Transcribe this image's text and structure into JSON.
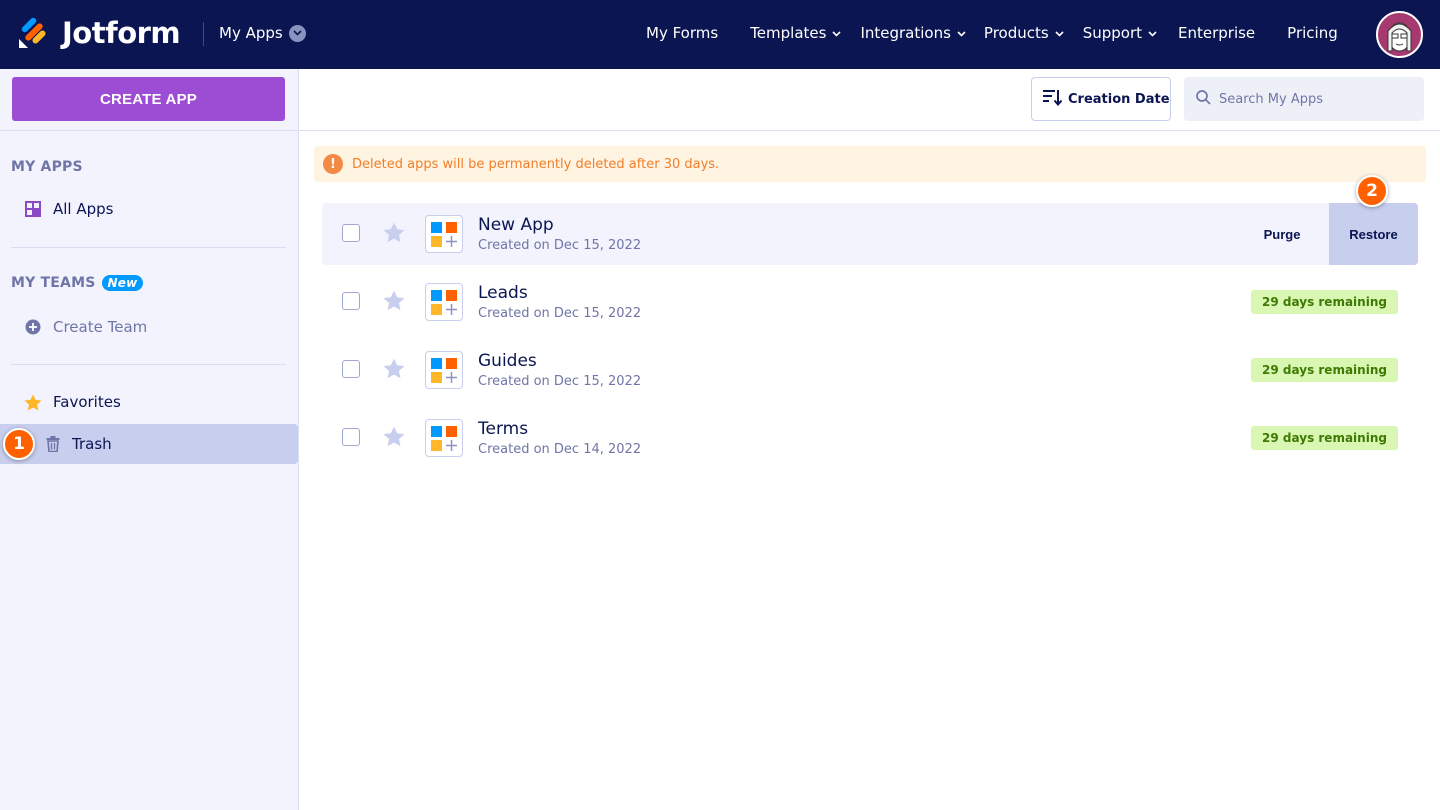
{
  "nav": {
    "brand": "Jotform",
    "switcher_label": "My Apps",
    "links": [
      {
        "label": "My Forms",
        "dropdown": false
      },
      {
        "label": "Templates",
        "dropdown": true
      },
      {
        "label": "Integrations",
        "dropdown": true
      },
      {
        "label": "Products",
        "dropdown": true
      },
      {
        "label": "Support",
        "dropdown": true
      },
      {
        "label": "Enterprise",
        "dropdown": false
      },
      {
        "label": "Pricing",
        "dropdown": false
      }
    ]
  },
  "sidebar": {
    "create_button": "CREATE APP",
    "my_apps_heading": "MY APPS",
    "all_apps": "All Apps",
    "my_teams_heading": "MY TEAMS",
    "new_badge": "New",
    "create_team": "Create Team",
    "favorites": "Favorites",
    "trash": "Trash"
  },
  "toolbar": {
    "sort_label": "Creation Date",
    "search_placeholder": "Search My Apps"
  },
  "banner": {
    "icon": "!",
    "text": "Deleted apps will be permanently deleted after 30 days."
  },
  "apps": [
    {
      "title": "New App",
      "date": "Created on Dec 15, 2022",
      "status": ""
    },
    {
      "title": "Leads",
      "date": "Created on Dec 15, 2022",
      "status": "29 days remaining"
    },
    {
      "title": "Guides",
      "date": "Created on Dec 15, 2022",
      "status": "29 days remaining"
    },
    {
      "title": "Terms",
      "date": "Created on Dec 14, 2022",
      "status": "29 days remaining"
    }
  ],
  "row_actions": {
    "purge": "Purge",
    "restore": "Restore"
  },
  "step_markers": {
    "one": "1",
    "two": "2"
  },
  "colors": {
    "nav_bg": "#0a1551",
    "create_button": "#9c4dd3",
    "active_item": "#c8ceed",
    "step_marker": "#ff6100",
    "banner_bg": "#fff4e2",
    "days_badge": "#d9f7b2"
  },
  "icons": {
    "logo": "jotform-logo-icon",
    "switcher": "chevron-down-icon",
    "all_apps": "grid-icon",
    "create_team": "plus-circle-icon",
    "favorites": "star-icon",
    "trash": "trash-icon",
    "sort": "sort-icon",
    "search": "search-icon",
    "warning": "warning-icon",
    "app": "app-icon"
  }
}
